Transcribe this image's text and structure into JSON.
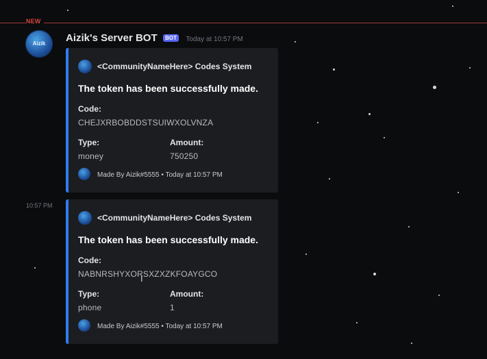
{
  "divider": {
    "label": "NEW"
  },
  "message": {
    "author": "Aizik's Server BOT",
    "bot_tag": "BOT",
    "timestamp": "Today at 10:57 PM",
    "avatar_text": "Aizik"
  },
  "side_timestamp": "10:57 PM",
  "embeds": [
    {
      "author": "<CommunityNameHere> Codes System",
      "title": "The token has been successfully made.",
      "code_label": "Code:",
      "code": "CHEJXRBOBDDSTSUIWXOLVNZA",
      "type_label": "Type:",
      "type": "money",
      "amount_label": "Amount:",
      "amount": "750250",
      "footer": "Made By Aizik#5555 • Today at 10:57 PM"
    },
    {
      "author": "<CommunityNameHere> Codes System",
      "title": "The token has been successfully made.",
      "code_label": "Code:",
      "code": "NABNRSHYXORSXZXZKFOAYGCO",
      "type_label": "Type:",
      "type": "phone",
      "amount_label": "Amount:",
      "amount": "1",
      "footer": "Made By Aizik#5555 • Today at 10:57 PM"
    }
  ],
  "colors": {
    "background": "#0b0c0e",
    "new_divider": "#d6453d",
    "embed_accent": "#2e7df0",
    "bot_tag": "#5865f2"
  },
  "icons": {
    "cursor": "text-cursor-icon"
  }
}
